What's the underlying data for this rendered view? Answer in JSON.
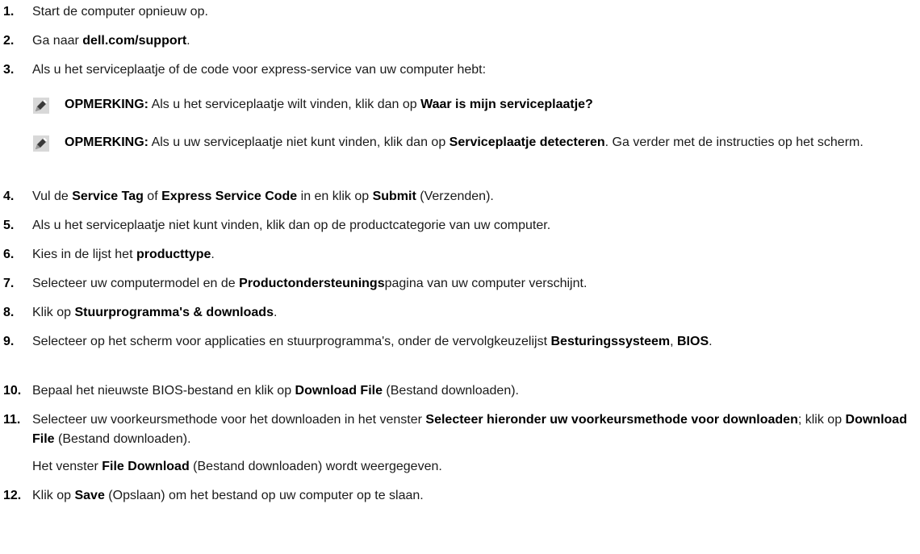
{
  "steps": [
    {
      "num": "1.",
      "parts": [
        {
          "t": "Start de computer opnieuw op.",
          "b": false
        }
      ]
    },
    {
      "num": "2.",
      "parts": [
        {
          "t": "Ga naar ",
          "b": false
        },
        {
          "t": "dell.com/support",
          "b": true
        },
        {
          "t": ".",
          "b": false
        }
      ]
    },
    {
      "num": "3.",
      "parts": [
        {
          "t": "Als u het serviceplaatje of de code voor express-service van uw computer hebt:",
          "b": false
        }
      ]
    },
    {
      "num": "4.",
      "parts": [
        {
          "t": "Vul de ",
          "b": false
        },
        {
          "t": "Service Tag",
          "b": true
        },
        {
          "t": " of ",
          "b": false
        },
        {
          "t": "Express Service Code",
          "b": true
        },
        {
          "t": " in en klik op ",
          "b": false
        },
        {
          "t": "Submit",
          "b": true
        },
        {
          "t": " (Verzenden).",
          "b": false
        }
      ]
    },
    {
      "num": "5.",
      "parts": [
        {
          "t": "Als u het serviceplaatje niet kunt vinden, klik dan op de productcategorie van uw computer.",
          "b": false
        }
      ]
    },
    {
      "num": "6.",
      "parts": [
        {
          "t": "Kies in de lijst het ",
          "b": false
        },
        {
          "t": "producttype",
          "b": true
        },
        {
          "t": ".",
          "b": false
        }
      ]
    },
    {
      "num": "7.",
      "parts": [
        {
          "t": "Selecteer uw computermodel en de ",
          "b": false
        },
        {
          "t": "Productondersteunings",
          "b": true
        },
        {
          "t": "pagina van uw computer verschijnt.",
          "b": false
        }
      ]
    },
    {
      "num": "8.",
      "parts": [
        {
          "t": "Klik op ",
          "b": false
        },
        {
          "t": "Stuurprogramma's & downloads",
          "b": true
        },
        {
          "t": ".",
          "b": false
        }
      ]
    },
    {
      "num": "9.",
      "parts": [
        {
          "t": "Selecteer op het scherm voor applicaties en stuurprogramma's, onder de vervolgkeuzelijst ",
          "b": false
        },
        {
          "t": "Besturingssysteem",
          "b": true
        },
        {
          "t": ", ",
          "b": false
        },
        {
          "t": "BIOS",
          "b": true
        },
        {
          "t": ".",
          "b": false
        }
      ]
    },
    {
      "num": "10.",
      "parts": [
        {
          "t": "Bepaal het nieuwste BIOS-bestand en klik op ",
          "b": false
        },
        {
          "t": "Download File",
          "b": true
        },
        {
          "t": " (Bestand downloaden).",
          "b": false
        }
      ]
    },
    {
      "num": "11.",
      "parts": [
        {
          "t": "Selecteer uw voorkeursmethode voor het downloaden in het venster ",
          "b": false
        },
        {
          "t": "Selecteer hieronder uw voorkeursmethode voor downloaden",
          "b": true
        },
        {
          "t": "; klik op ",
          "b": false
        },
        {
          "t": "Download File",
          "b": true
        },
        {
          "t": " (Bestand downloaden).",
          "b": false
        }
      ]
    },
    {
      "num": "12.",
      "parts": [
        {
          "t": "Klik op ",
          "b": false
        },
        {
          "t": "Save",
          "b": true
        },
        {
          "t": " (Opslaan) om het bestand op uw computer op te slaan.",
          "b": false
        }
      ]
    }
  ],
  "notes": [
    {
      "label": "OPMERKING:",
      "parts": [
        {
          "t": " Als u het serviceplaatje wilt vinden, klik dan op ",
          "b": false
        },
        {
          "t": "Waar is mijn serviceplaatje?",
          "b": true
        }
      ]
    },
    {
      "label": "OPMERKING:",
      "parts": [
        {
          "t": " Als u uw serviceplaatje niet kunt vinden, klik dan op ",
          "b": false
        },
        {
          "t": "Serviceplaatje detecteren",
          "b": true
        },
        {
          "t": ". Ga verder met de instructies op het scherm.",
          "b": false
        }
      ]
    }
  ],
  "sub11": {
    "parts": [
      {
        "t": "Het venster ",
        "b": false
      },
      {
        "t": "File Download",
        "b": true
      },
      {
        "t": " (Bestand downloaden) wordt weergegeven.",
        "b": false
      }
    ]
  },
  "icons": {
    "note": "pencil-note-icon"
  }
}
